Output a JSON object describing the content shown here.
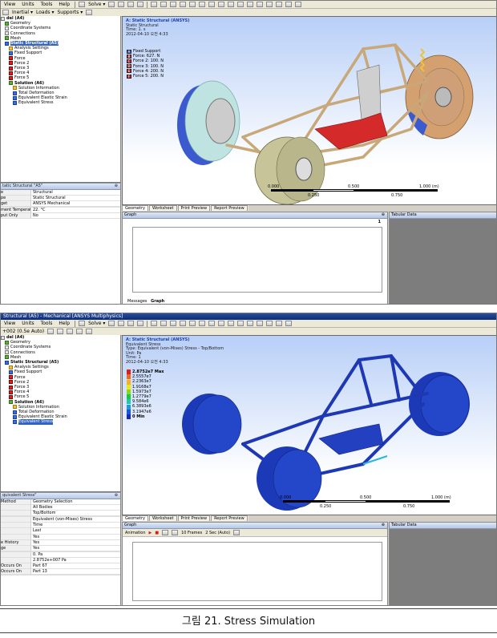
{
  "caption": "그림 21. Stress Simulation",
  "shot1": {
    "menu": [
      "View",
      "Units",
      "Tools",
      "Help"
    ],
    "toolbar_text": [
      "Solve ▾",
      "Inertial ▾",
      "Loads ▾",
      "Supports ▾"
    ],
    "tree": [
      {
        "label": "del (A4)",
        "bold": true,
        "icon": ""
      },
      {
        "label": "Geometry",
        "icon": "green"
      },
      {
        "label": "Coordinate Systems",
        "icon": ""
      },
      {
        "label": "Connections",
        "icon": ""
      },
      {
        "label": "Mesh",
        "icon": "green"
      },
      {
        "label": "Static Structural (A5)",
        "bold": true,
        "highlight": true,
        "icon": "blue"
      },
      {
        "label": "Analysis Settings",
        "icon": "yellow"
      },
      {
        "label": "Fixed Support",
        "icon": "blue"
      },
      {
        "label": "Force",
        "icon": "red"
      },
      {
        "label": "Force 2",
        "icon": "red"
      },
      {
        "label": "Force 3",
        "icon": "red"
      },
      {
        "label": "Force 4",
        "icon": "red"
      },
      {
        "label": "Force 5",
        "icon": "red"
      },
      {
        "label": "Solution (A6)",
        "bold": true,
        "icon": "green"
      },
      {
        "label": "Solution Information",
        "icon": "yellow"
      },
      {
        "label": "Total Deformation",
        "icon": "blue"
      },
      {
        "label": "Equivalent Elastic Strain",
        "icon": "blue"
      },
      {
        "label": "Equivalent Stress",
        "icon": "blue"
      }
    ],
    "details_title": "tatic Structural \"A5\"",
    "details": [
      {
        "k": "e",
        "v": "Structural"
      },
      {
        "k": "pe",
        "v": "Static Structural"
      },
      {
        "k": "get",
        "v": "ANSYS Mechanical"
      },
      {
        "k": "",
        "v": ""
      },
      {
        "k": "ment Temperature",
        "v": "22. °C"
      },
      {
        "k": "put Only",
        "v": "No"
      }
    ],
    "viewport": {
      "title": "A: Static Structural (ANSYS)",
      "lines": [
        "Static Structural",
        "Time: 1. s",
        "2012-04-10 오전 4:33"
      ]
    },
    "legend": [
      {
        "code": "A",
        "label": "Fixed Support",
        "color": "#3a4fc9"
      },
      {
        "code": "B",
        "label": "Force: 627. N",
        "color": "#cc2020"
      },
      {
        "code": "C",
        "label": "Force 2: 100. N",
        "color": "#cc2020"
      },
      {
        "code": "D",
        "label": "Force 3: 100. N",
        "color": "#cc2020"
      },
      {
        "code": "E",
        "label": "Force 4: 200. N",
        "color": "#cc2020"
      },
      {
        "code": "F",
        "label": "Force 5: 200. N",
        "color": "#cc2020"
      }
    ],
    "scale": {
      "t0": "0.000",
      "t1": "0.500",
      "t2": "1.000 (m)",
      "m1": "0.250",
      "m2": "0.750"
    },
    "tabs": [
      "Geometry",
      "Worksheet",
      "Print Preview",
      "Report Preview"
    ],
    "graph_title": "Graph",
    "graph_marker": "1",
    "tabular_title": "Tabular Data",
    "bottom_tabs": [
      "Messages",
      "Graph"
    ]
  },
  "shot2": {
    "title_text": "Structural (A5) - Mechanical [ANSYS Multiphysics]",
    "menu": [
      "View",
      "Units",
      "Tools",
      "Help"
    ],
    "toolbar_text": [
      "Solve ▾"
    ],
    "toolbar2_text": [
      "+002 (0.5e Auto)"
    ],
    "tree": [
      {
        "label": "del (A4)",
        "bold": true,
        "icon": ""
      },
      {
        "label": "Geometry",
        "icon": "green"
      },
      {
        "label": "Coordinate Systems",
        "icon": ""
      },
      {
        "label": "Connections",
        "icon": ""
      },
      {
        "label": "Mesh",
        "icon": "green"
      },
      {
        "label": "Static Structural (A5)",
        "bold": true,
        "icon": "blue"
      },
      {
        "label": "Analysis Settings",
        "icon": "yellow"
      },
      {
        "label": "Fixed Support",
        "icon": "blue"
      },
      {
        "label": "Force",
        "icon": "red"
      },
      {
        "label": "Force 2",
        "icon": "red"
      },
      {
        "label": "Force 3",
        "icon": "red"
      },
      {
        "label": "Force 4",
        "icon": "red"
      },
      {
        "label": "Force 5",
        "icon": "red"
      },
      {
        "label": "Solution (A6)",
        "bold": true,
        "icon": "green"
      },
      {
        "label": "Solution Information",
        "icon": "yellow"
      },
      {
        "label": "Total Deformation",
        "icon": "blue"
      },
      {
        "label": "Equivalent Elastic Strain",
        "icon": "blue"
      },
      {
        "label": "Equivalent Stress",
        "icon": "blue",
        "highlight": true
      }
    ],
    "details_title": "quivalent Stress\"",
    "details": [
      {
        "k": "Method",
        "v": "Geometry Selection"
      },
      {
        "k": "",
        "v": "All Bodies"
      },
      {
        "k": "",
        "v": "Top/Bottom"
      },
      {
        "k": "",
        "v": ""
      },
      {
        "k": "",
        "v": "Equivalent (von-Mises) Stress"
      },
      {
        "k": "",
        "v": "Time"
      },
      {
        "k": "",
        "v": "Last"
      },
      {
        "k": "",
        "v": "Yes"
      },
      {
        "k": "e History",
        "v": "Yes"
      },
      {
        "k": "ge",
        "v": "Yes"
      },
      {
        "k": "",
        "v": ""
      },
      {
        "k": "",
        "v": "0. Pa"
      },
      {
        "k": "",
        "v": "2.8752e+007 Pa"
      },
      {
        "k": "Occurs On",
        "v": "Part 67"
      },
      {
        "k": "Occurs On",
        "v": "Part 13"
      },
      {
        "k": "",
        "v": ""
      }
    ],
    "viewport": {
      "title": "A: Static Structural (ANSYS)",
      "lines": [
        "Equivalent Stress",
        "Type: Equivalent (von-Mises) Stress - Top/Bottom",
        "Unit: Pa",
        "Time: 1",
        "2012-04-10 오전 4:33"
      ]
    },
    "stress_legend": [
      {
        "label": "2.8752e7 Max",
        "color": "#d81e1e"
      },
      {
        "label": "2.5557e7",
        "color": "#f06a16"
      },
      {
        "label": "2.2363e7",
        "color": "#f4b21c"
      },
      {
        "label": "1.9168e7",
        "color": "#e8e81c"
      },
      {
        "label": "1.5973e7",
        "color": "#8ad81c"
      },
      {
        "label": "1.2779e7",
        "color": "#1ec83c"
      },
      {
        "label": "9.584e6",
        "color": "#1cc8b4"
      },
      {
        "label": "6.3893e6",
        "color": "#1c9ad8"
      },
      {
        "label": "3.1947e6",
        "color": "#1c56d8"
      },
      {
        "label": "0 Min",
        "color": "#1c28b0"
      }
    ],
    "scale": {
      "t0": "0.000",
      "t1": "0.500",
      "t2": "1.000 (m)",
      "m1": "0.250",
      "m2": "0.750"
    },
    "tabs": [
      "Geometry",
      "Worksheet",
      "Print Preview",
      "Report Preview"
    ],
    "graph_title": "Graph",
    "animation_label": "Animation",
    "frames_label": "10 Frames",
    "sec_label": "2 Sec (Auto)",
    "tabular_title": "Tabular Data"
  }
}
